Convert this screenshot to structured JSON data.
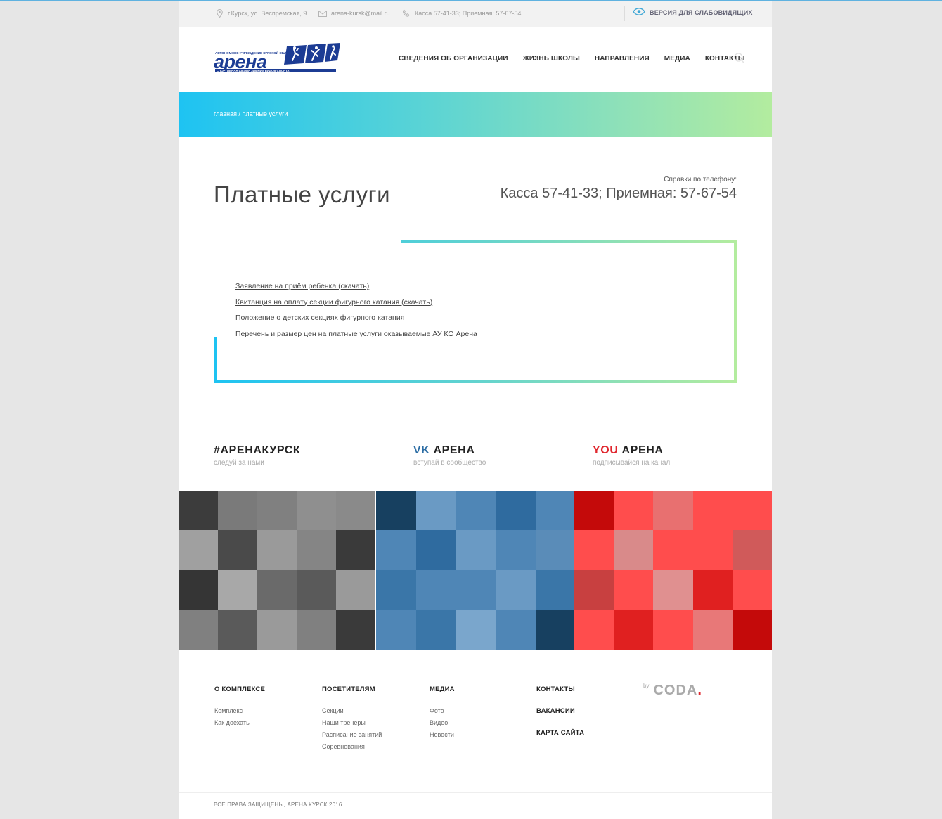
{
  "topbar": {
    "address": "г.Курск, ул. Веспремская, 9",
    "email": "arena-kursk@mail.ru",
    "phone": "Касса 57-41-33; Приемная: 57-67-54",
    "vision_label": "ВЕРСИЯ ДЛЯ СЛАБОВИДЯЩИХ"
  },
  "logo": {
    "top_text": "АВТОНОМНОЕ УЧРЕЖДЕНИЕ КУРСКОЙ ОБЛАСТИ",
    "word": "арена",
    "subtitle": "СПОРТИВНАЯ ШКОЛА ЗИМНИХ ВИДОВ СПОРТА"
  },
  "nav": [
    {
      "label": "СВЕДЕНИЯ ОБ ОРГАНИЗАЦИИ"
    },
    {
      "label": "ЖИЗНЬ ШКОЛЫ"
    },
    {
      "label": "НАПРАВЛЕНИЯ"
    },
    {
      "label": "МЕДИА"
    },
    {
      "label": "КОНТАКТЫ"
    }
  ],
  "breadcrumb": {
    "home": "главная",
    "sep": " / ",
    "current": "платные услуги"
  },
  "page": {
    "title": "Платные услуги",
    "phone_label": "Справки по телефону:",
    "phone": "Касса 57-41-33; Приемная: 57-67-54"
  },
  "documents": [
    {
      "label": "Заявление на приём ребенка (скачать)"
    },
    {
      "label": "Квитанция на оплату секции фигурного катания (скачать)"
    },
    {
      "label": "Положение о детских секциях фигурного катания"
    },
    {
      "label": "Перечень и размер цен на платные услуги оказываемые АУ КО Арена"
    }
  ],
  "social": {
    "insta": {
      "title": "#АРЕНАКУРСК",
      "sub": "следуй за нами"
    },
    "vk": {
      "prefix": "VK",
      "title": " АРЕНА",
      "sub": "вступай в сообщество"
    },
    "youtube": {
      "prefix": "YOU",
      "title": " АРЕНА",
      "sub": "подписывайся на канал"
    }
  },
  "footer": {
    "col1": {
      "title": "О КОМПЛЕКСЕ",
      "links": [
        "Комплекс",
        "Как доехать"
      ]
    },
    "col2": {
      "title": "ПОСЕТИТЕЛЯМ",
      "links": [
        "Секции",
        "Наши тренеры",
        "Расписание занятий",
        "Соревнования"
      ]
    },
    "col3": {
      "title": "МЕДИА",
      "links": [
        "Фото",
        "Видео",
        "Новости"
      ]
    },
    "col4": {
      "contacts": "КОНТАКТЫ",
      "jobs": "ВАКАНСИИ",
      "sitemap": "КАРТА САЙТА"
    },
    "coda": {
      "by": "by",
      "word": "CODA",
      "dot": "."
    },
    "copyright": "ВСЕ ПРАВА ЗАЩИЩЕНЫ, АРЕНА КУРСК 2016"
  },
  "colors": {
    "accent_blue": "#1ec3f2",
    "accent_green": "#b3ec9f",
    "logo_blue": "#1c3c94",
    "vk": "#2d6ea5",
    "youtube": "#e0262d"
  }
}
